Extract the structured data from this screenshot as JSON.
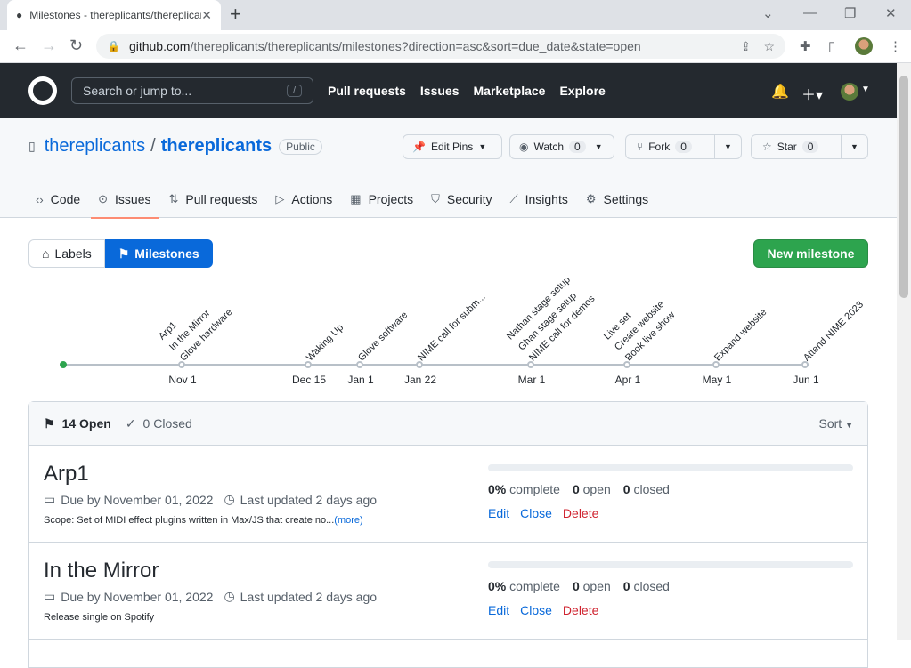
{
  "browser": {
    "tab_title": "Milestones - thereplicants/thereplicants",
    "url_host": "github.com",
    "url_path": "/thereplicants/thereplicants/milestones?direction=asc&sort=due_date&state=open"
  },
  "header": {
    "search_placeholder": "Search or jump to...",
    "search_key": "/",
    "nav": [
      "Pull requests",
      "Issues",
      "Marketplace",
      "Explore"
    ]
  },
  "repo": {
    "owner": "thereplicants",
    "name": "thereplicants",
    "visibility": "Public",
    "edit_pins": "Edit Pins",
    "watch_label": "Watch",
    "watch_count": "0",
    "fork_label": "Fork",
    "fork_count": "0",
    "star_label": "Star",
    "star_count": "0",
    "tabs": [
      "Code",
      "Issues",
      "Pull requests",
      "Actions",
      "Projects",
      "Security",
      "Insights",
      "Settings"
    ]
  },
  "subnav": {
    "labels": "Labels",
    "milestones": "Milestones",
    "new_milestone": "New milestone"
  },
  "timeline": {
    "milestones": [
      "Arp1",
      "In the Mirror",
      "Glove hardware",
      "Waking Up",
      "Glove software",
      "NIME call for subm...",
      "Nathan stage setup",
      "Ghan stage setup",
      "NIME call for demos",
      "Live set",
      "Create website",
      "Book live show",
      "Expand website",
      "Attend NIME 2023"
    ],
    "dates": [
      "Nov 1",
      "Dec 15",
      "Jan 1",
      "Jan 22",
      "Mar 1",
      "Apr 1",
      "May 1",
      "Jun 1"
    ]
  },
  "list": {
    "open_count": "14 Open",
    "closed_count": "0 Closed",
    "sort_label": "Sort",
    "rows": [
      {
        "title": "Arp1",
        "due": "Due by November 01, 2022",
        "updated": "Last updated 2 days ago",
        "description": "Scope: Set of MIDI effect plugins written in Max/JS that create no...",
        "more": "(more)",
        "progress": 0,
        "complete": "0%",
        "complete_label": "complete",
        "open_n": "0",
        "open_label": "open",
        "closed_n": "0",
        "closed_label": "closed",
        "edit": "Edit",
        "close": "Close",
        "delete": "Delete"
      },
      {
        "title": "In the Mirror",
        "due": "Due by November 01, 2022",
        "updated": "Last updated 2 days ago",
        "description": "Release single on Spotify",
        "more": "",
        "progress": 0,
        "complete": "0%",
        "complete_label": "complete",
        "open_n": "0",
        "open_label": "open",
        "closed_n": "0",
        "closed_label": "closed",
        "edit": "Edit",
        "close": "Close",
        "delete": "Delete"
      }
    ]
  }
}
